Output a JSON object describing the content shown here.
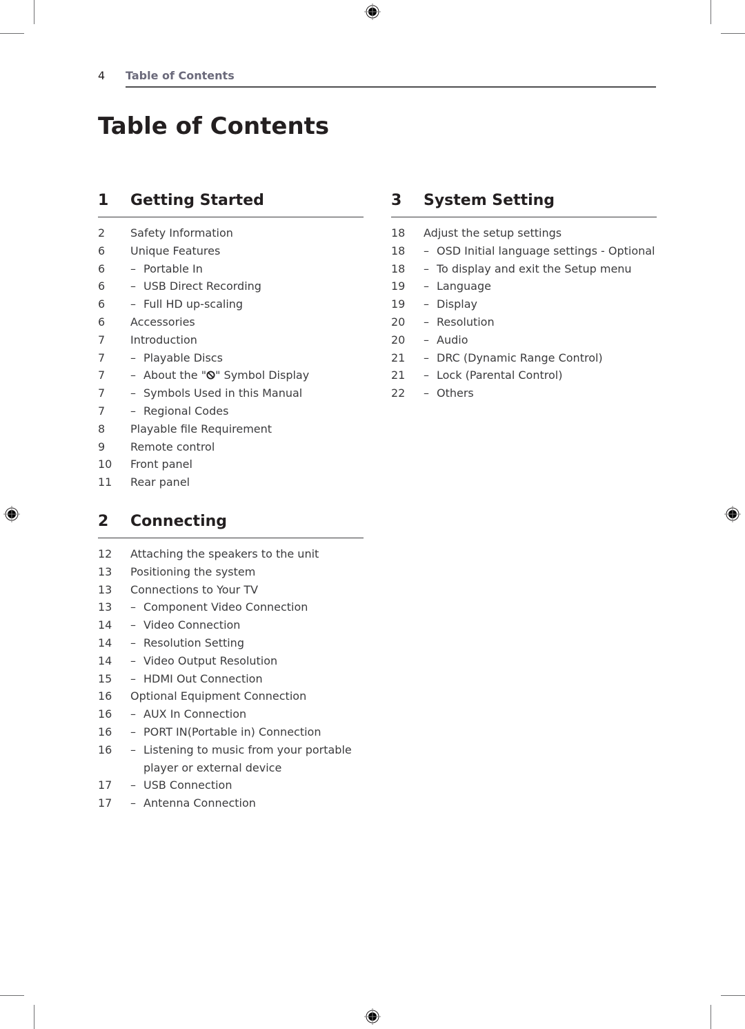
{
  "running_header": {
    "page_number": "4",
    "title": "Table of Contents"
  },
  "page_title": "Table of Contents",
  "sections": [
    {
      "number": "1",
      "title": "Getting Started",
      "entries": [
        {
          "page": "2",
          "text": "Safety Information",
          "sub": false
        },
        {
          "page": "6",
          "text": "Unique Features",
          "sub": false
        },
        {
          "page": "6",
          "text": "Portable In",
          "sub": true
        },
        {
          "page": "6",
          "text": "USB Direct Recording",
          "sub": true
        },
        {
          "page": "6",
          "text": "Full HD up-scaling",
          "sub": true
        },
        {
          "page": "6",
          "text": "Accessories",
          "sub": false
        },
        {
          "page": "7",
          "text": "Introduction",
          "sub": false
        },
        {
          "page": "7",
          "text": "Playable Discs",
          "sub": true
        },
        {
          "page": "7",
          "text_before": "About the \"",
          "icon": "prohibit-icon",
          "text_after": "\" Symbol Display",
          "sub": true
        },
        {
          "page": "7",
          "text": "Symbols Used in this Manual",
          "sub": true
        },
        {
          "page": "7",
          "text": "Regional Codes",
          "sub": true
        },
        {
          "page": "8",
          "text": "Playable file Requirement",
          "sub": false
        },
        {
          "page": "9",
          "text": "Remote control",
          "sub": false
        },
        {
          "page": "10",
          "text": "Front panel",
          "sub": false
        },
        {
          "page": "11",
          "text": "Rear panel",
          "sub": false
        }
      ]
    },
    {
      "number": "2",
      "title": "Connecting",
      "entries": [
        {
          "page": "12",
          "text": "Attaching the speakers to the unit",
          "sub": false
        },
        {
          "page": "13",
          "text": "Positioning the system",
          "sub": false
        },
        {
          "page": "13",
          "text": "Connections to Your TV",
          "sub": false
        },
        {
          "page": "13",
          "text": "Component Video Connection",
          "sub": true
        },
        {
          "page": "14",
          "text": "Video Connection",
          "sub": true
        },
        {
          "page": "14",
          "text": "Resolution Setting",
          "sub": true
        },
        {
          "page": "14",
          "text": "Video Output Resolution",
          "sub": true
        },
        {
          "page": "15",
          "text": "HDMI Out Connection",
          "sub": true
        },
        {
          "page": "16",
          "text": "Optional Equipment Connection",
          "sub": false
        },
        {
          "page": "16",
          "text": "AUX In Connection",
          "sub": true
        },
        {
          "page": "16",
          "text": "PORT IN(Portable in) Connection",
          "sub": true
        },
        {
          "page": "16",
          "text": "Listening to music from your portable player or external device",
          "sub": true
        },
        {
          "page": "17",
          "text": "USB Connection",
          "sub": true
        },
        {
          "page": "17",
          "text": "Antenna Connection",
          "sub": true
        }
      ]
    },
    {
      "number": "3",
      "title": "System Setting",
      "entries": [
        {
          "page": "18",
          "text": "Adjust the setup settings",
          "sub": false
        },
        {
          "page": "18",
          "text": "OSD Initial language settings - Optional",
          "sub": true
        },
        {
          "page": "18",
          "text": "To display and exit the Setup menu",
          "sub": true
        },
        {
          "page": "19",
          "text": "Language",
          "sub": true
        },
        {
          "page": "19",
          "text": "Display",
          "sub": true
        },
        {
          "page": "20",
          "text": "Resolution",
          "sub": true
        },
        {
          "page": "20",
          "text": "Audio",
          "sub": true
        },
        {
          "page": "21",
          "text": "DRC (Dynamic Range Control)",
          "sub": true
        },
        {
          "page": "21",
          "text": "Lock (Parental Control)",
          "sub": true
        },
        {
          "page": "22",
          "text": "Others",
          "sub": true
        }
      ]
    }
  ],
  "dash": "–"
}
